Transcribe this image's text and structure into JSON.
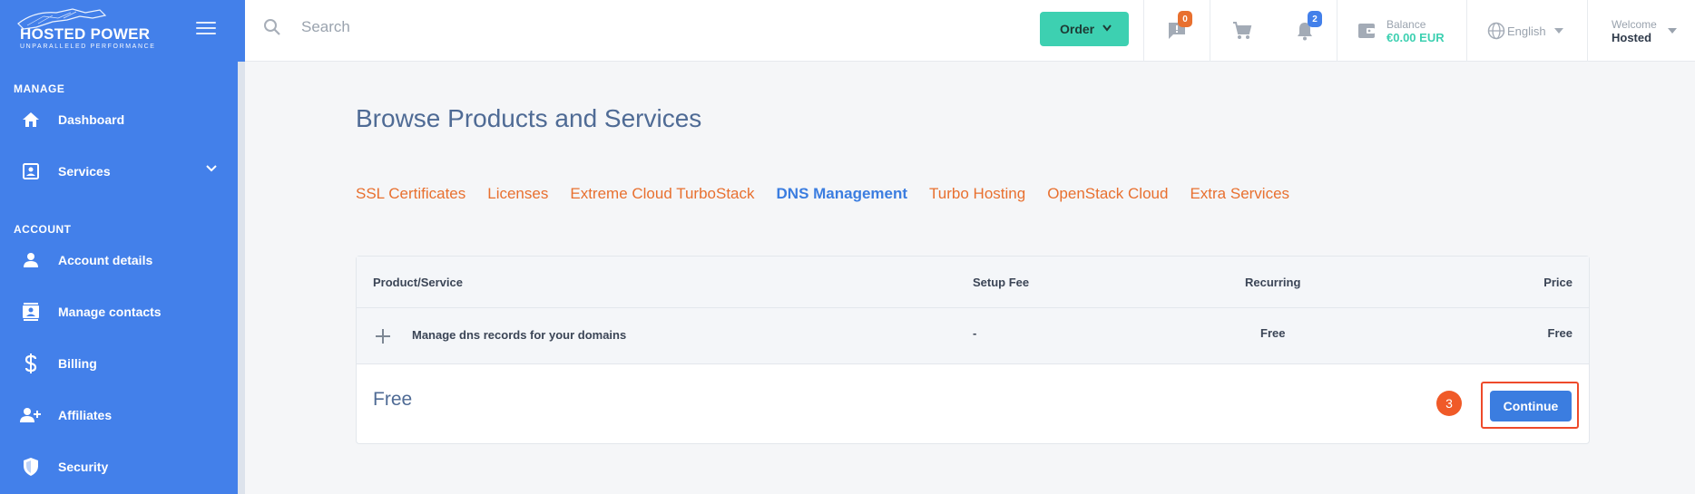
{
  "brand": {
    "name": "HOSTED POWER",
    "tagline": "UNPARALLELED PERFORMANCE"
  },
  "search": {
    "placeholder": "Search"
  },
  "header": {
    "order_label": "Order",
    "messages_count": "0",
    "notifications_count": "2",
    "balance_label": "Balance",
    "balance_value": "€0.00 EUR",
    "language": "English",
    "welcome_label": "Welcome",
    "user_name": "Hosted"
  },
  "sidebar": {
    "manage_label": "MANAGE",
    "account_label": "ACCOUNT",
    "items": [
      {
        "label": "Dashboard",
        "icon": "home-icon"
      },
      {
        "label": "Services",
        "icon": "services-icon"
      },
      {
        "label": "Account details",
        "icon": "user-icon"
      },
      {
        "label": "Manage contacts",
        "icon": "contacts-icon"
      },
      {
        "label": "Billing",
        "icon": "dollar-icon"
      },
      {
        "label": "Affiliates",
        "icon": "affiliates-icon"
      },
      {
        "label": "Security",
        "icon": "shield-icon"
      }
    ]
  },
  "main": {
    "title": "Browse Products and Services",
    "tabs": [
      {
        "label": "SSL Certificates"
      },
      {
        "label": "Licenses"
      },
      {
        "label": "Extreme Cloud TurboStack"
      },
      {
        "label": "DNS Management",
        "active": true
      },
      {
        "label": "Turbo Hosting"
      },
      {
        "label": "OpenStack Cloud"
      },
      {
        "label": "Extra Services"
      }
    ],
    "table": {
      "headers": [
        "Product/Service",
        "Setup Fee",
        "Recurring",
        "Price"
      ],
      "row": {
        "product": "Manage dns records for your domains",
        "setup_fee": "-",
        "recurring": "Free",
        "price": "Free"
      }
    },
    "total": "Free",
    "step_number": "3",
    "continue_label": "Continue"
  },
  "colors": {
    "sidebar": "#4380ea",
    "accent_teal": "#3dd0b1",
    "tab_orange": "#e8702f",
    "active_blue": "#3b7de0",
    "highlight_red": "#ee4a2a"
  }
}
